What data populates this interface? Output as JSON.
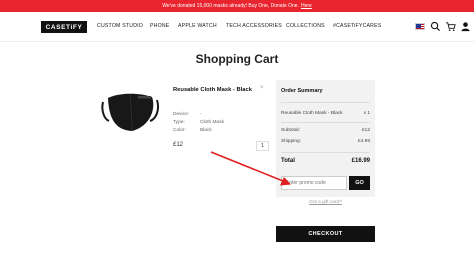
{
  "banner": {
    "text": "We've donated 15,000 masks already! Buy One, Donate One.",
    "link": "Here"
  },
  "nav": {
    "logo": "CASETiFY",
    "links": [
      "CUSTOM STUDIO",
      "PHONE",
      "APPLE WATCH",
      "TECH ACCESSORIES",
      "COLLECTIONS",
      "#CASETiFYCARES"
    ],
    "icons": [
      "us-flag-icon",
      "search-icon",
      "cart-icon",
      "account-icon"
    ]
  },
  "page_title": "Shopping Cart",
  "cart_item": {
    "name": "Reusable Cloth Mask - Black",
    "details": [
      {
        "label": "Device:",
        "value": "-"
      },
      {
        "label": "Type:",
        "value": "Cloth Mask"
      },
      {
        "label": "Color:",
        "value": "Black"
      }
    ],
    "price": "£12",
    "quantity": "1",
    "remove": "×"
  },
  "summary": {
    "title": "Order Summary",
    "line_item": "Reusable Cloth Mask - Black",
    "line_qty": "x 1",
    "subtotal_label": "Subtotal:",
    "subtotal_value": "£12",
    "shipping_label": "Shipping:",
    "shipping_value": "£4.99",
    "total_label": "Total",
    "total_value": "£16.99",
    "promo_placeholder": "Enter promo code",
    "go_label": "GO"
  },
  "gift_card_link": "Got a gift card?",
  "checkout_label": "CHECKOUT",
  "colors": {
    "banner": "#e8242f",
    "dark": "#111111",
    "summary_bg": "#f2f2f2",
    "annotation_arrow": "#e02020"
  }
}
